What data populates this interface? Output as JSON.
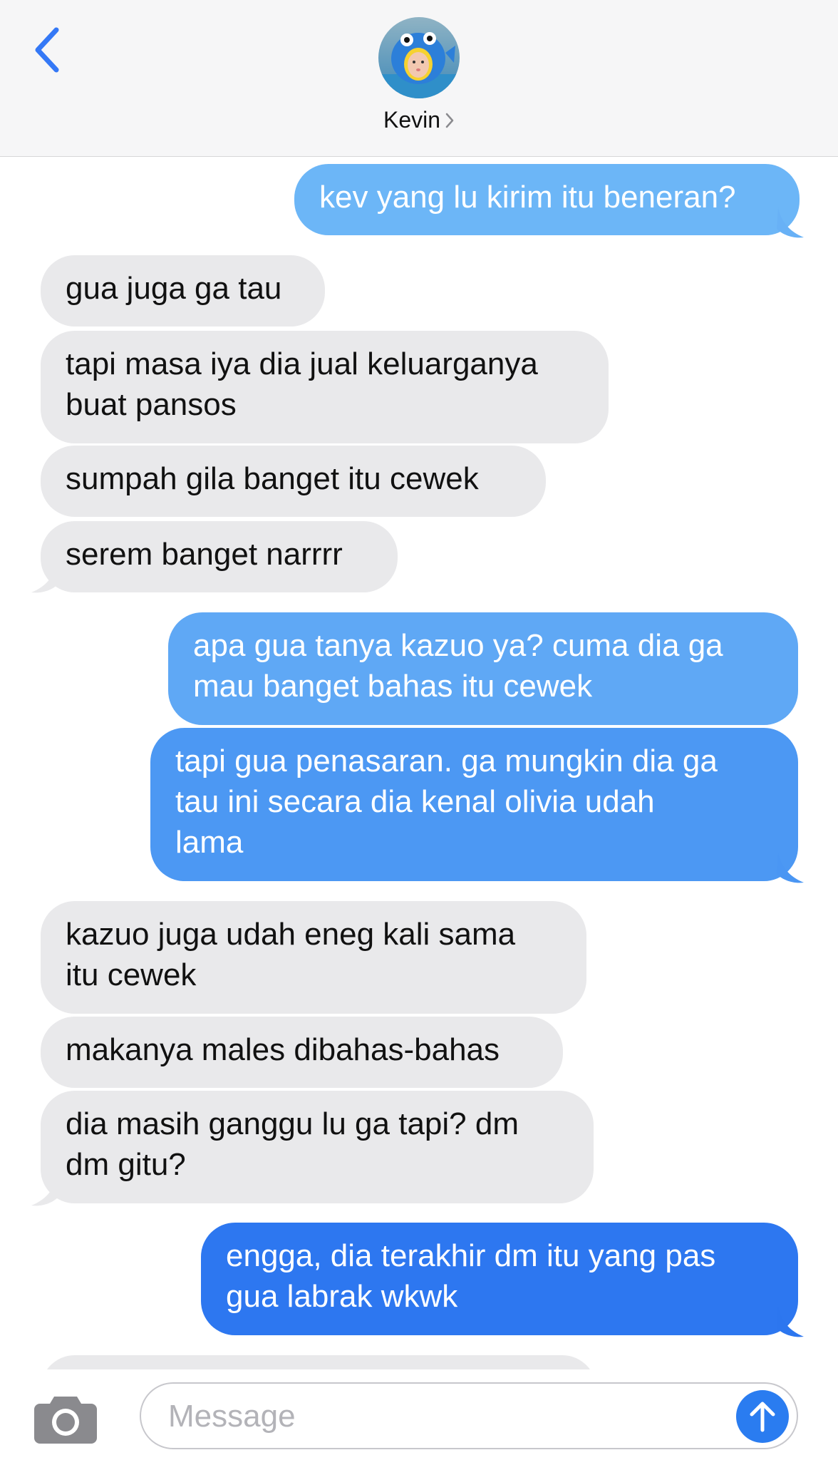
{
  "header": {
    "contact_name": "Kevin",
    "back_icon": "chevron-left-icon",
    "disclosure_icon": "chevron-right-icon",
    "accent_color": "#3478f6"
  },
  "messages": [
    {
      "direction": "outgoing",
      "text": "kev yang lu kirim itu beneran?"
    },
    {
      "direction": "incoming",
      "text": "gua juga ga tau"
    },
    {
      "direction": "incoming",
      "text": "tapi masa iya dia jual keluarganya\nbuat pansos"
    },
    {
      "direction": "incoming",
      "text": "sumpah gila banget itu cewek"
    },
    {
      "direction": "incoming",
      "text": "serem banget narrrr"
    },
    {
      "direction": "outgoing",
      "text": "apa gua tanya kazuo ya? cuma dia ga\nmau banget bahas itu cewek"
    },
    {
      "direction": "outgoing",
      "text": "tapi gua penasaran. ga mungkin dia ga\ntau ini secara dia kenal olivia udah\nlama"
    },
    {
      "direction": "incoming",
      "text": "kazuo juga udah eneg kali sama\nitu cewek"
    },
    {
      "direction": "incoming",
      "text": "makanya males dibahas-bahas"
    },
    {
      "direction": "incoming",
      "text": "dia masih ganggu lu ga tapi? dm\ndm gitu?"
    },
    {
      "direction": "outgoing",
      "text": "engga, dia terakhir dm itu yang pas\ngua labrak wkwk"
    }
  ],
  "input_bar": {
    "placeholder": "Message",
    "camera_icon": "camera-icon",
    "send_icon": "arrow-up-icon"
  },
  "colors": {
    "incoming_bubble": "#e9e9eb",
    "outgoing_gradient_top": "#6cb6f7",
    "outgoing_gradient_bottom": "#2a73ef",
    "header_bg": "#f6f6f7"
  }
}
